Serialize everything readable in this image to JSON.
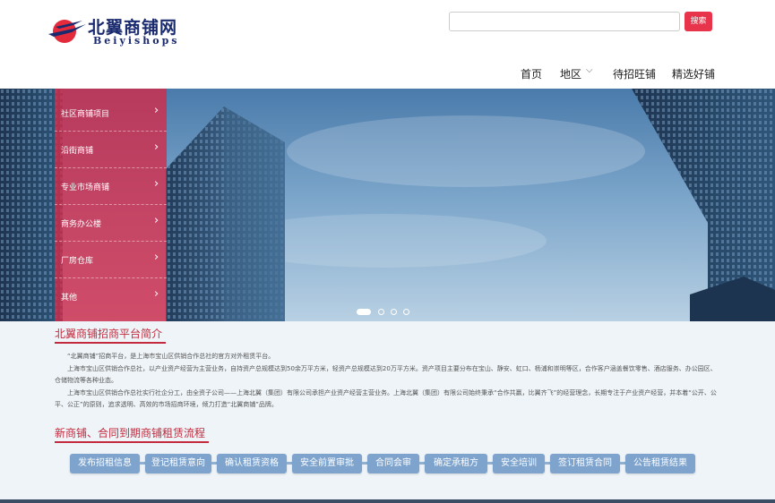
{
  "header": {
    "logo_cn": "北翼商铺网",
    "logo_en": "Beiyishops",
    "search_placeholder": "",
    "search_button": "搜索"
  },
  "nav": {
    "home": "首页",
    "region": "地区",
    "pending": "待招旺铺",
    "selected": "精选好铺"
  },
  "side_menu": [
    {
      "label": "社区商铺项目"
    },
    {
      "label": "沿街商铺"
    },
    {
      "label": "专业市场商铺"
    },
    {
      "label": "商务办公楼"
    },
    {
      "label": "厂房仓库"
    },
    {
      "label": "其他"
    }
  ],
  "carousel": {
    "total": 4,
    "active": 1
  },
  "intro": {
    "title": "北翼商铺招商平台简介",
    "paragraphs": [
      "“北翼商铺”招商平台，是上海市宝山区供销合作总社的官方对外租赁平台。",
      "上海市宝山区供销合作总社，以产业资产经营为主营业务，自持资产总规模达到50余万平方米，轻资产总规模达到20万平方米。资产项目主要分布在宝山、静安、虹口、杨浦和崇明等区，合作客户涵盖餐饮零售、酒店服务、办公园区、仓储物流等各种业态。",
      "上海市宝山区供销合作总社实行社企分工，由全资子公司——上海北翼（集团）有限公司承担产业资产经营主营业务。上海北翼（集团）有限公司始终秉承“合作共赢，比翼齐飞”的经营理念，长期专注于产业资产经营，并本着“公开、公平、公正”的原则，追求透明、高效的市场招商环境，倾力打造“北翼商铺”品牌。"
    ]
  },
  "process": {
    "title": "新商铺、合同到期商铺租赁流程",
    "steps": [
      "发布招租信息",
      "登记租赁意向",
      "确认租赁资格",
      "安全前置审批",
      "合同会审",
      "确定承租方",
      "安全培训",
      "签订租赁合同",
      "公告租赁结果"
    ]
  },
  "colors": {
    "accent": "#e8344b",
    "side_menu": "#d62846",
    "step": "#7ea3cc",
    "title": "#c32a3d"
  }
}
